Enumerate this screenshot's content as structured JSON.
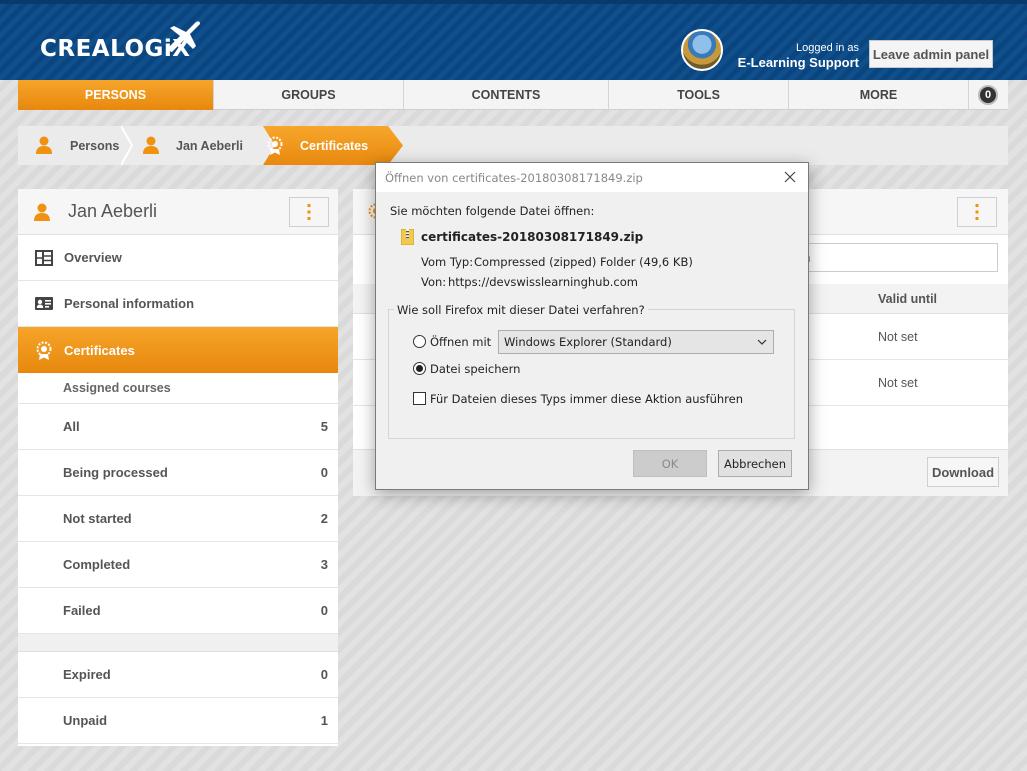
{
  "header": {
    "logo": "CREALOGiX",
    "logged_in_label": "Logged in as",
    "user_name": "E-Learning Support",
    "admin_button": "Leave admin panel"
  },
  "nav": {
    "items": [
      {
        "label": "PERSONS",
        "active": true
      },
      {
        "label": "GROUPS",
        "active": false
      },
      {
        "label": "CONTENTS",
        "active": false
      },
      {
        "label": "TOOLS",
        "active": false
      },
      {
        "label": "MORE",
        "active": false
      }
    ],
    "badge": "0"
  },
  "breadcrumb": {
    "items": [
      "Persons",
      "Jan Aeberli",
      "Certificates"
    ]
  },
  "left_panel": {
    "name": "Jan Aeberli",
    "menu": [
      {
        "label": "Overview",
        "icon": "overview-grid-icon"
      },
      {
        "label": "Personal information",
        "icon": "id-card-icon"
      },
      {
        "label": "Certificates",
        "icon": "certificate-icon",
        "active": true
      }
    ],
    "section_title": "Assigned courses",
    "rows": [
      {
        "label": "All",
        "count": "5"
      },
      {
        "label": "Being processed",
        "count": "0"
      },
      {
        "label": "Not started",
        "count": "2"
      },
      {
        "label": "Completed",
        "count": "3"
      },
      {
        "label": "Failed",
        "count": "0"
      }
    ],
    "rows2": [
      {
        "label": "Expired",
        "count": "0"
      },
      {
        "label": "Unpaid",
        "count": "1"
      }
    ]
  },
  "right_panel": {
    "search_placeholder_tail": "h",
    "column_valid_until": "Valid until",
    "values": [
      "Not set",
      "Not set"
    ],
    "download_button": "Download"
  },
  "dialog": {
    "title": "Öffnen von certificates-20180308171849.zip",
    "intro": "Sie möchten folgende Datei öffnen:",
    "file_name": "certificates-20180308171849.zip",
    "type_label": "Vom Typ:",
    "type_value": "Compressed (zipped) Folder (49,6 KB)",
    "from_label": "Von:",
    "from_value": "https://devswisslearninghub.com",
    "question": "Wie soll Firefox mit dieser Datei verfahren?",
    "open_with_label": "Öffnen mit",
    "open_with_value": "Windows Explorer (Standard)",
    "save_label": "Datei speichern",
    "always_label": "Für Dateien dieses Typs immer diese Aktion ausführen",
    "ok_button": "OK",
    "cancel_button": "Abbrechen"
  },
  "colors": {
    "header_blue": "#0e4f8c",
    "accent_orange": "#f39c1d"
  }
}
